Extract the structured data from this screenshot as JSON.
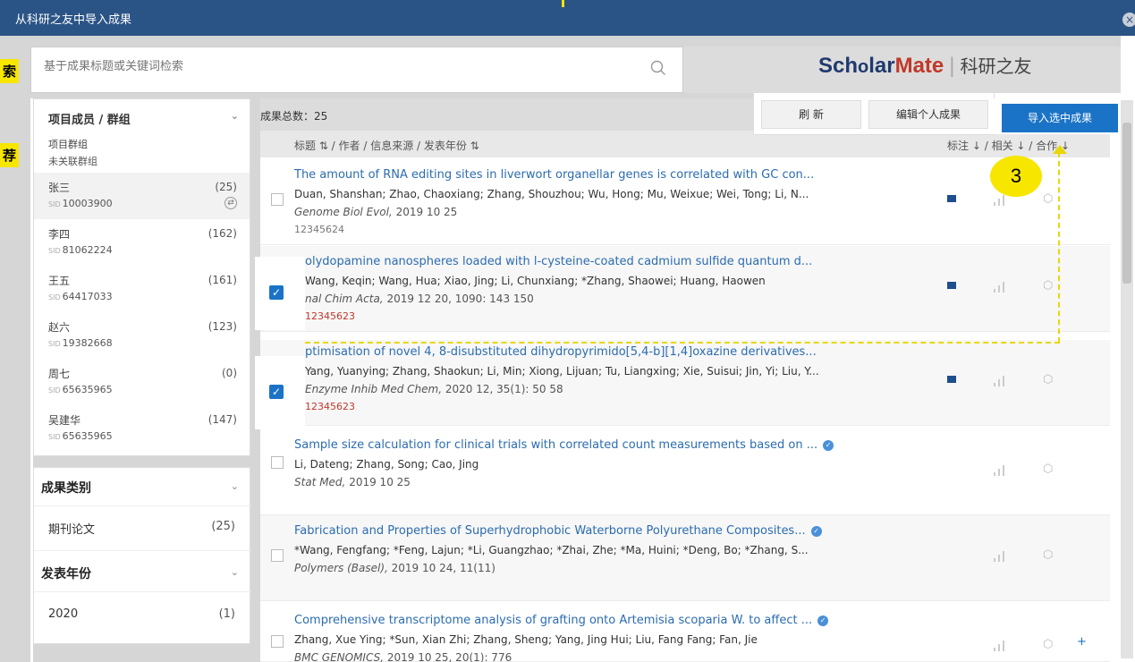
{
  "window": {
    "title": "从科研之友中导入成果",
    "close_glyph": "×"
  },
  "annotations": {
    "search_tag": "索",
    "recommend_tag": "荐",
    "step_badge": "3"
  },
  "search": {
    "placeholder": "基于成果标题或关键词检索"
  },
  "logo": {
    "scholar": "Sch",
    "o": "o",
    "lar": "lar",
    "mate": "Mate",
    "sep": "|",
    "cn": "科研之友"
  },
  "sidebar": {
    "header": "项目成员 / 群组",
    "group_item": {
      "name": "项目群组",
      "sub": "未关联群组"
    },
    "members": [
      {
        "name": "张三",
        "sid": "10003900",
        "count": "(25)",
        "active": true
      },
      {
        "name": "李四",
        "sid": "81062224",
        "count": "(162)"
      },
      {
        "name": "王五",
        "sid": "64417033",
        "count": "(161)"
      },
      {
        "name": "赵六",
        "sid": "19382668",
        "count": "(123)"
      },
      {
        "name": "周七",
        "sid": "65635965",
        "count": "(0)"
      },
      {
        "name": "吴建华",
        "sid": "65635965",
        "count": "(147)"
      }
    ],
    "sid_label": "SID"
  },
  "filters": {
    "category_header": "成果类别",
    "category_item": "期刊论文",
    "category_count": "(25)",
    "year_header": "发表年份",
    "year_item": "2020",
    "year_count": "(1)"
  },
  "main": {
    "total": "成果总数：25",
    "columns": "标题 ⇅ / 作者 / 信息来源 / 发表年份 ⇅",
    "sort_columns": "标注 ↓ / 相关 ↓ / 合作 ↓",
    "buttons": {
      "refresh": "刷 新",
      "edit": "编辑个人成果",
      "import": "导入选中成果"
    }
  },
  "rows": [
    {
      "title": "The amount of RNA editing sites in liverwort organellar genes is correlated with GC con...",
      "authors": "Duan, Shanshan; Zhao, Chaoxiang; Zhang, Shouzhou; Wu, Hong; Mu, Weixue; Wei, Tong; Li, N...",
      "journal": "Genome Biol Evol,",
      "year": "2019 10 25",
      "code": "12345624"
    },
    {
      "title": "olydopamine nanospheres loaded with l-cysteine-coated cadmium sulfide quantum d...",
      "authors": "Wang, Keqin; Wang, Hua; Xiao, Jing; Li, Chunxiang; *Zhang, Shaowei; Huang, Haowen",
      "journal": "nal Chim Acta,",
      "year": "2019 12 20, 1090: 143 150",
      "code": "12345623"
    },
    {
      "title": "ptimisation of novel 4, 8-disubstituted dihydropyrimido[5,4-b][1,4]oxazine derivatives...",
      "authors": "Yang, Yuanying; Zhang, Shaokun; Li, Min; Xiong, Lijuan; Tu, Liangxing; Xie, Suisui; Jin, Yi; Liu, Y...",
      "journal": "Enzyme Inhib Med Chem,",
      "year": "2020 12, 35(1): 50 58",
      "code": "12345623"
    },
    {
      "title": "Sample size calculation for clinical trials with correlated count measurements based on ...",
      "authors": "Li, Dateng; Zhang, Song; Cao, Jing",
      "journal": "Stat Med,",
      "year": "2019 10 25",
      "code": ""
    },
    {
      "title": "Fabrication and Properties of Superhydrophobic Waterborne Polyurethane Composites...",
      "authors": "*Wang, Fengfang; *Feng, Lajun; *Li, Guangzhao; *Zhai, Zhe; *Ma, Huini; *Deng, Bo; *Zhang, S...",
      "journal": "Polymers (Basel),",
      "year": "2019 10 24, 11(11)",
      "code": ""
    },
    {
      "title": "Comprehensive transcriptome analysis of grafting onto Artemisia scoparia W. to affect ...",
      "authors": "Zhang, Xue Ying; *Sun, Xian Zhi; Zhang, Sheng; Yang, Jing Hui; Liu, Fang Fang; Fan, Jie",
      "journal": "BMC GENOMICS,",
      "year": "2019 10 25, 20(1): 776",
      "code": ""
    }
  ],
  "colors": {
    "titlebar": "#2b5486",
    "accent": "#1a73c6",
    "highlight": "#f7e600",
    "mate": "#c0392b"
  }
}
